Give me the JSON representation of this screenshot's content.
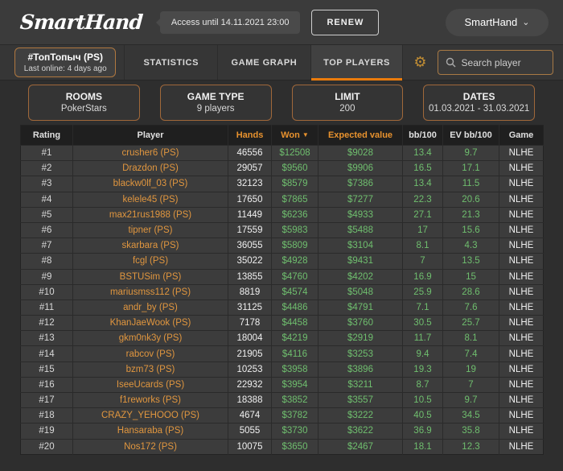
{
  "header": {
    "logo": "SmartHand",
    "access_label": "Access until 14.11.2021 23:00",
    "renew_label": "RENEW",
    "account_label": "SmartHand"
  },
  "icons": {
    "gear": "⚙",
    "chevron_down": "⌄",
    "sort_desc": "▼"
  },
  "tabs": {
    "player_tab": {
      "title": "#ТопТопыч (PS)",
      "subtitle": "Last online: 4 days ago"
    },
    "statistics": "STATISTICS",
    "game_graph": "GAME GRAPH",
    "top_players": "TOP PLAYERS",
    "active_tab": "TOP PLAYERS",
    "search_placeholder": "Search player",
    "search_value": ""
  },
  "filters": {
    "rooms": {
      "label": "ROOMS",
      "value": "PokerStars"
    },
    "game_type": {
      "label": "GAME TYPE",
      "value": "9 players"
    },
    "limit": {
      "label": "LIMIT",
      "value": "200"
    },
    "dates": {
      "label": "DATES",
      "value": "01.03.2021 - 31.03.2021"
    }
  },
  "table": {
    "columns": [
      "Rating",
      "Player",
      "Hands",
      "Won",
      "Expected value",
      "bb/100",
      "EV bb/100",
      "Game"
    ],
    "sort_column": "Won",
    "sort_direction": "desc",
    "rows": [
      [
        "#1",
        "crusher6 (PS)",
        "46556",
        "$12508",
        "$9028",
        "13.4",
        "9.7",
        "NLHE"
      ],
      [
        "#2",
        "Drazdon (PS)",
        "29057",
        "$9560",
        "$9906",
        "16.5",
        "17.1",
        "NLHE"
      ],
      [
        "#3",
        "blackw0lf_03 (PS)",
        "32123",
        "$8579",
        "$7386",
        "13.4",
        "11.5",
        "NLHE"
      ],
      [
        "#4",
        "kelele45 (PS)",
        "17650",
        "$7865",
        "$7277",
        "22.3",
        "20.6",
        "NLHE"
      ],
      [
        "#5",
        "max21rus1988 (PS)",
        "11449",
        "$6236",
        "$4933",
        "27.1",
        "21.3",
        "NLHE"
      ],
      [
        "#6",
        "tipner (PS)",
        "17559",
        "$5983",
        "$5488",
        "17",
        "15.6",
        "NLHE"
      ],
      [
        "#7",
        "skarbara (PS)",
        "36055",
        "$5809",
        "$3104",
        "8.1",
        "4.3",
        "NLHE"
      ],
      [
        "#8",
        "fcgl (PS)",
        "35022",
        "$4928",
        "$9431",
        "7",
        "13.5",
        "NLHE"
      ],
      [
        "#9",
        "BSTUSim (PS)",
        "13855",
        "$4760",
        "$4202",
        "16.9",
        "15",
        "NLHE"
      ],
      [
        "#10",
        "mariusmss112 (PS)",
        "8819",
        "$4574",
        "$5048",
        "25.9",
        "28.6",
        "NLHE"
      ],
      [
        "#11",
        "andr_by (PS)",
        "31125",
        "$4486",
        "$4791",
        "7.1",
        "7.6",
        "NLHE"
      ],
      [
        "#12",
        "KhanJaeWook (PS)",
        "7178",
        "$4458",
        "$3760",
        "30.5",
        "25.7",
        "NLHE"
      ],
      [
        "#13",
        "gkm0nk3y (PS)",
        "18004",
        "$4219",
        "$2919",
        "11.7",
        "8.1",
        "NLHE"
      ],
      [
        "#14",
        "rabcov (PS)",
        "21905",
        "$4116",
        "$3253",
        "9.4",
        "7.4",
        "NLHE"
      ],
      [
        "#15",
        "bzm73 (PS)",
        "10253",
        "$3958",
        "$3896",
        "19.3",
        "19",
        "NLHE"
      ],
      [
        "#16",
        "IseeUcards (PS)",
        "22932",
        "$3954",
        "$3211",
        "8.7",
        "7",
        "NLHE"
      ],
      [
        "#17",
        "f1reworks (PS)",
        "18388",
        "$3852",
        "$3557",
        "10.5",
        "9.7",
        "NLHE"
      ],
      [
        "#18",
        "CRAZY_YEHOOO (PS)",
        "4674",
        "$3782",
        "$3222",
        "40.5",
        "34.5",
        "NLHE"
      ],
      [
        "#19",
        "Hansaraba (PS)",
        "5055",
        "$3730",
        "$3622",
        "36.9",
        "35.8",
        "NLHE"
      ],
      [
        "#20",
        "Nos172 (PS)",
        "10075",
        "$3650",
        "$2467",
        "18.1",
        "12.3",
        "NLHE"
      ]
    ]
  },
  "colors": {
    "accent_orange": "#ea7b0c",
    "orange_text": "#e0963f",
    "green_text": "#6fbe6e",
    "page_bg": "#2e2e2e",
    "header_bg": "#3b3b3b",
    "row_bg": "#3c3c3c",
    "table_header_bg": "#1f1f1f"
  }
}
